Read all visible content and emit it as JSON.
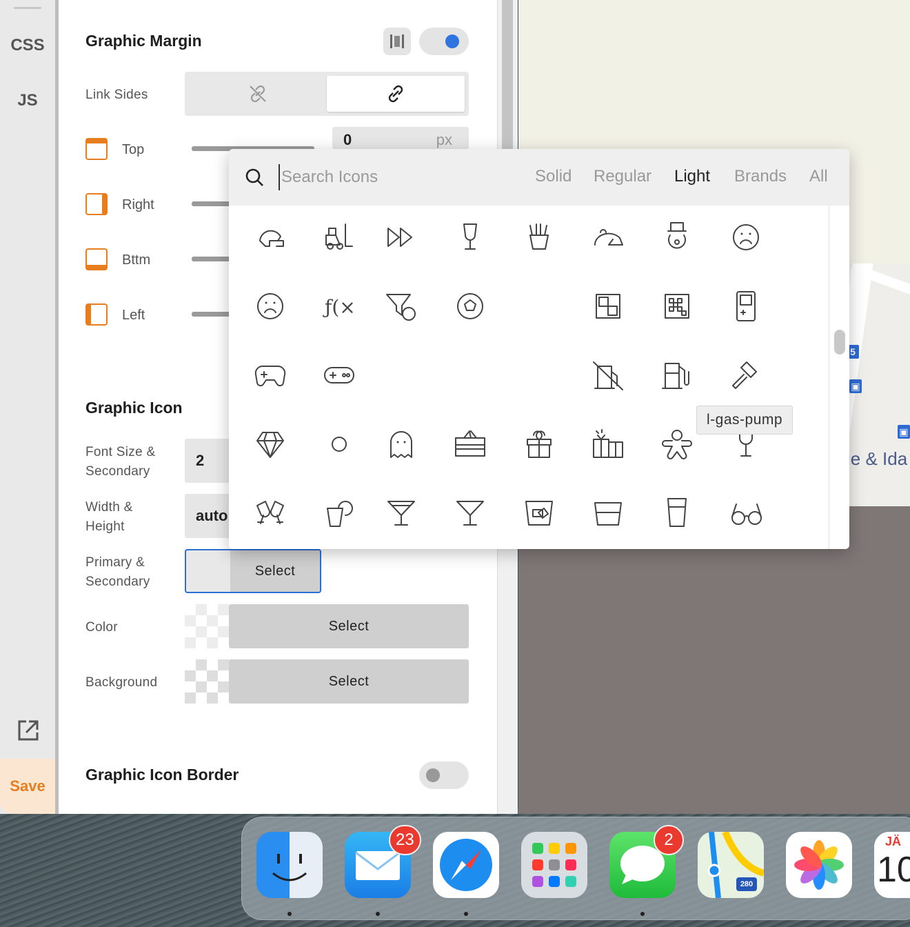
{
  "rail": {
    "tabs": [
      "CSS",
      "JS"
    ],
    "save_label": "Save"
  },
  "margin": {
    "title": "Graphic Margin",
    "link_sides_label": "Link Sides",
    "top_value": "0",
    "unit": "px",
    "sides": [
      "Top",
      "Right",
      "Bttm",
      "Left"
    ]
  },
  "icon": {
    "title": "Graphic Icon",
    "font_size_label": "Font Size & Secondary",
    "font_size_value": "2",
    "width_label": "Width & Height",
    "width_value": "auto",
    "primary_label": "Primary & Secondary",
    "color_label": "Color",
    "background_label": "Background",
    "select_label": "Select"
  },
  "border": {
    "title": "Graphic Icon Border"
  },
  "picker": {
    "placeholder": "Search Icons",
    "tabs": [
      "Solid",
      "Regular",
      "Light",
      "Brands",
      "All"
    ],
    "active_tab": "Light",
    "tooltip": "l-gas-pump",
    "icons": [
      "football-helmet-icon",
      "forklift-icon",
      "fast-forward-icon",
      "glass-whiskey-icon",
      "french-fries-icon",
      "frog-icon",
      "frosty-head-icon",
      "frown-icon",
      "frown-open-icon",
      "function-icon",
      "funnel-dollar-icon",
      "futbol-icon",
      "",
      "game-board-icon",
      "game-board-alt-icon",
      "game-console-handheld-icon",
      "gamepad-icon",
      "gamepad-alt-icon",
      "",
      "",
      "",
      "gas-pump-slash-icon",
      "gas-pump-icon",
      "gavel-icon",
      "gem-icon",
      "genderless-icon",
      "ghost-icon",
      "gift-card-icon",
      "gift-icon",
      "gifts-icon",
      "gingerbread-man-icon",
      "glass-icon",
      "glass-cheers-icon",
      "glass-citrus-icon",
      "glass-martini-icon",
      "glass-martini-alt-icon",
      "glass-whiskey-rocks-icon",
      "glass-whiskey-alt-icon",
      "glass-tall-icon",
      "glasses-icon"
    ]
  },
  "map": {
    "label": "le & Ida",
    "route_number": "5"
  },
  "dock": {
    "apps": [
      "Finder",
      "Mail",
      "Safari",
      "Launchpad",
      "Messages",
      "Maps",
      "Photos",
      "Calendar"
    ],
    "mail_badge": "23",
    "messages_badge": "2",
    "calendar_month": "JÄ",
    "calendar_day": "10",
    "maps_shield": "280"
  },
  "colors": {
    "accent": "#e67e1e",
    "toggle_on": "#2f74e0",
    "select_border": "#2a6fd6"
  }
}
